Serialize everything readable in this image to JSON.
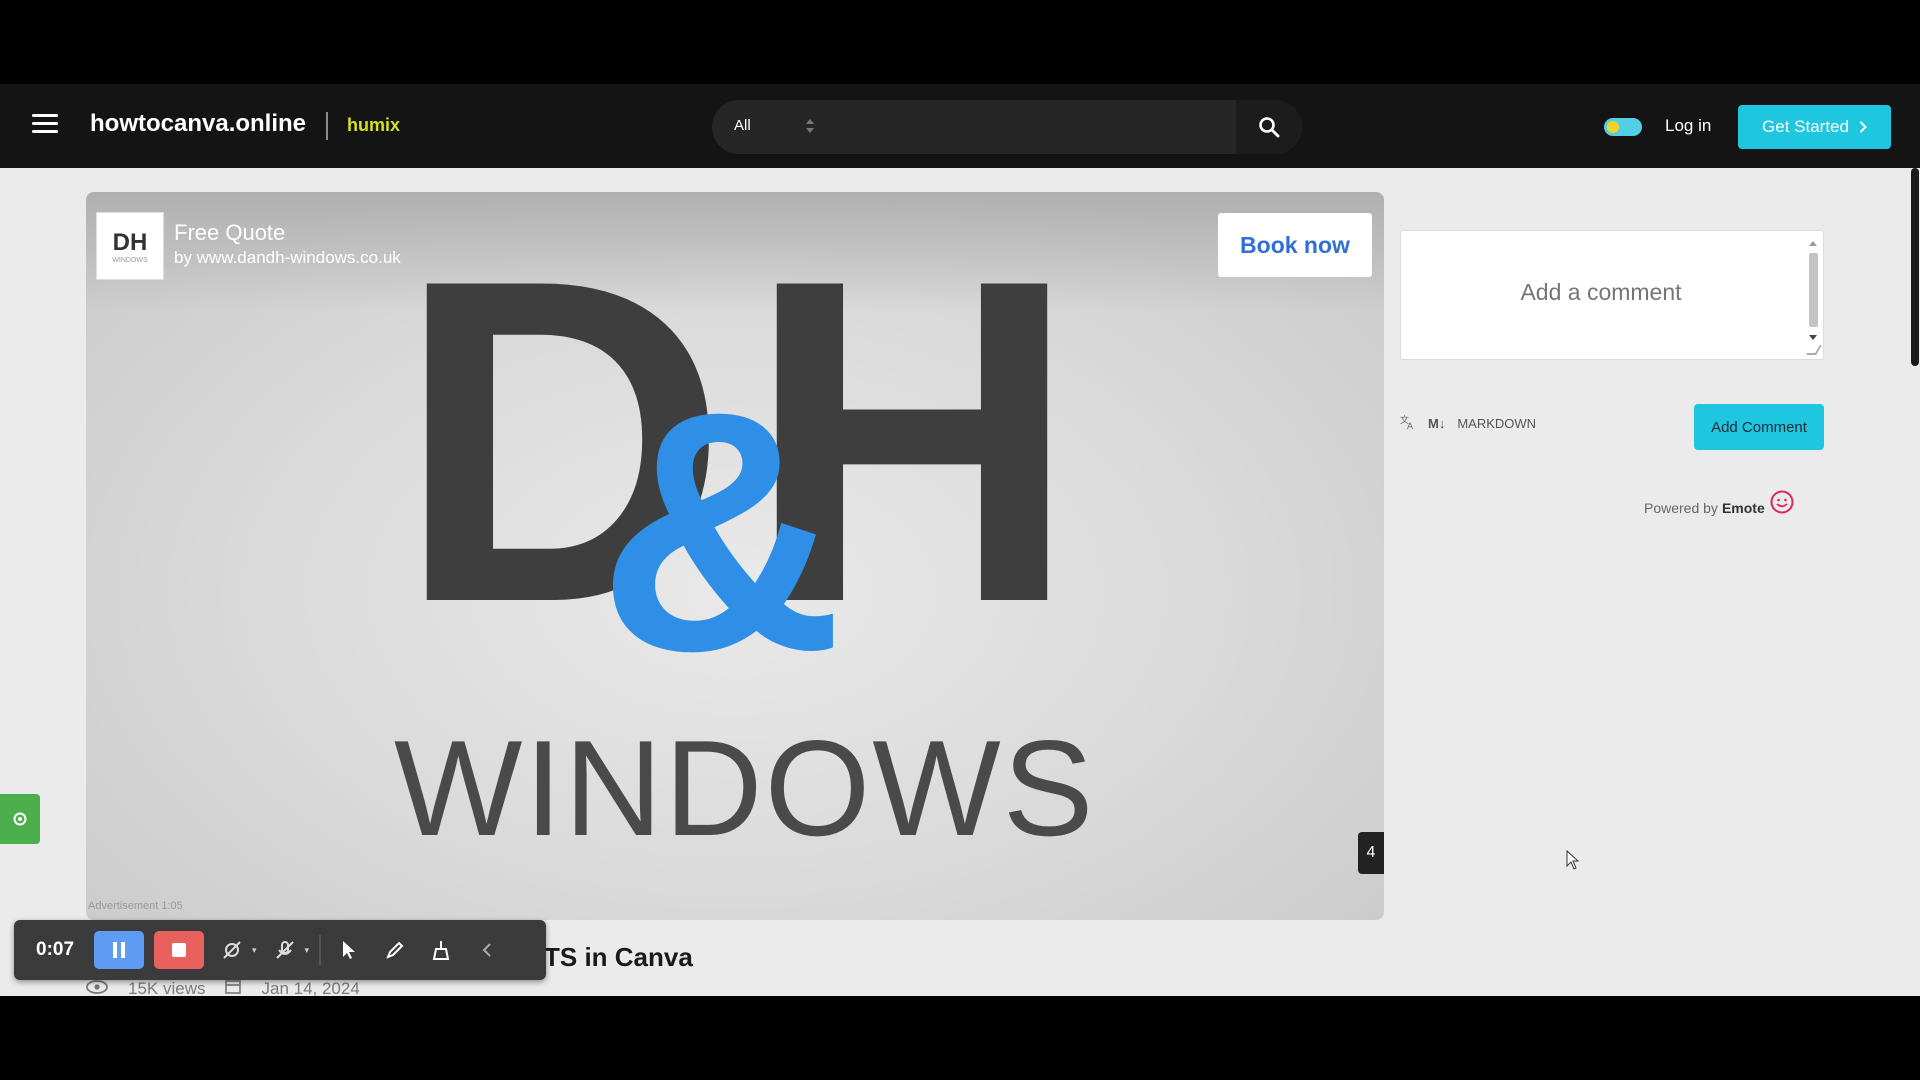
{
  "header": {
    "site_name": "howtocanva.online",
    "partner": "humix",
    "search": {
      "category": "All",
      "placeholder": ""
    },
    "login": "Log in",
    "get_started": "Get Started"
  },
  "ad": {
    "logo_text": "DH",
    "logo_sub": "WINDOWS",
    "title": "Free Quote",
    "by": "by www.dandh-windows.co.uk",
    "button": "Book now",
    "countdown": "4",
    "tag": "Advertisement 1:05"
  },
  "video_art": {
    "letter_left": "D",
    "ampersand": "&",
    "letter_right": "H",
    "word": "WINDOWS"
  },
  "article": {
    "title_partial": "TS in Canva",
    "views": "15K views",
    "date": "Jan 14, 2024"
  },
  "comments": {
    "placeholder": "Add a comment",
    "markdown_icon": "M↓",
    "markdown_label": "MARKDOWN",
    "add_button": "Add Comment",
    "powered_prefix": "Powered by",
    "powered_brand": "Emote"
  },
  "recorder": {
    "time": "0:07"
  },
  "colors": {
    "accent": "#1ec6e0",
    "partner": "#d4e021",
    "brand_blue": "#2f8fe6",
    "pause": "#5e9bf3",
    "stop": "#e9615c",
    "settings": "#4cae4c"
  },
  "icons": [
    "menu-icon",
    "search-icon",
    "chevron-right-icon",
    "translate-icon",
    "emote-smiley-icon",
    "gear-icon",
    "eye-icon",
    "calendar-icon",
    "pause-icon",
    "stop-icon",
    "camera-off-icon",
    "mic-off-icon",
    "pointer-icon",
    "pen-icon",
    "broom-icon",
    "chevron-left-icon"
  ]
}
